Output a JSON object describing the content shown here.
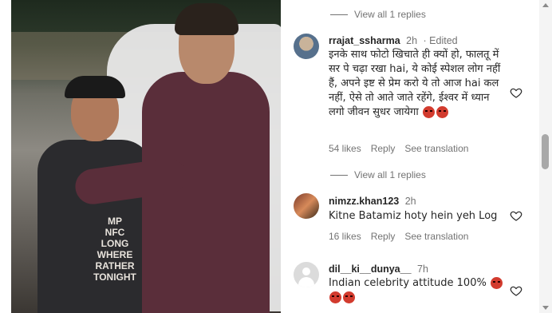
{
  "post": {
    "shirt_text": [
      "MP",
      "NFC",
      "LONG",
      "WHERE",
      "RATHER",
      "TONIGHT"
    ]
  },
  "comments": [
    {
      "view_replies": "View all 1 replies"
    },
    {
      "username": "rrajat_ssharma",
      "time": "2h",
      "edited": "· Edited",
      "text": "इनके साथ फोटो खिचाते ही क्यों हो, फालतू में सर पे चढ़ा रखा hai, ये कोई स्पेशल लोग नहीं हैं, अपने इष्ट से प्रेम करो ये तो आज hai कल नहीं, ऐसे तो आते जाते रहेंगे, ईश्वर में ध्यान लगो जीवन सुधर जायेगा",
      "likes": "54 likes",
      "reply": "Reply",
      "translate": "See translation",
      "view_replies": "View all 1 replies"
    },
    {
      "username": "nimzz.khan123",
      "time": "2h",
      "text": "Kitne Batamiz hoty hein yeh Log",
      "likes": "16 likes",
      "reply": "Reply",
      "translate": "See translation"
    },
    {
      "username": "dil__ki__dunya__",
      "time": "7h",
      "text": "Indian celebrity attitude 100%"
    }
  ],
  "icons": {
    "like": "heart-outline-icon",
    "emoji": "angry-face-emoji"
  },
  "colors": {
    "secondary_text": "#737373",
    "primary_text": "#262626"
  }
}
